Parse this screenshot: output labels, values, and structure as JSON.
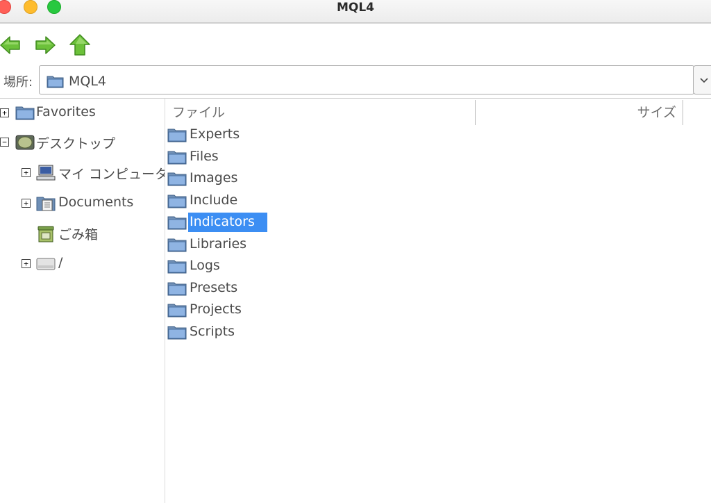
{
  "window": {
    "title": "MQL4"
  },
  "location": {
    "label": "場所:",
    "path": "MQL4"
  },
  "tree": [
    {
      "label": "Favorites",
      "expander": "+",
      "icon": "folder-icon"
    },
    {
      "label": "デスクトップ",
      "expander": "−",
      "icon": "desktop-icon"
    },
    {
      "label": "マイ コンピュータ",
      "expander": "+",
      "icon": "computer-icon"
    },
    {
      "label": "Documents",
      "expander": "+",
      "icon": "documents-icon"
    },
    {
      "label": "ごみ箱",
      "expander": "",
      "icon": "trash-icon"
    },
    {
      "label": "/",
      "expander": "+",
      "icon": "drive-icon"
    }
  ],
  "columns": {
    "name": "ファイル",
    "size": "サイズ"
  },
  "files": [
    {
      "name": "Experts"
    },
    {
      "name": "Files"
    },
    {
      "name": "Images"
    },
    {
      "name": "Include"
    },
    {
      "name": "Indicators",
      "selected": true
    },
    {
      "name": "Libraries"
    },
    {
      "name": "Logs"
    },
    {
      "name": "Presets"
    },
    {
      "name": "Projects"
    },
    {
      "name": "Scripts"
    }
  ],
  "colors": {
    "selection": "#3c8ef3",
    "arrow_green": "#5cb82e",
    "folder_blue": "#5b8fd6"
  }
}
